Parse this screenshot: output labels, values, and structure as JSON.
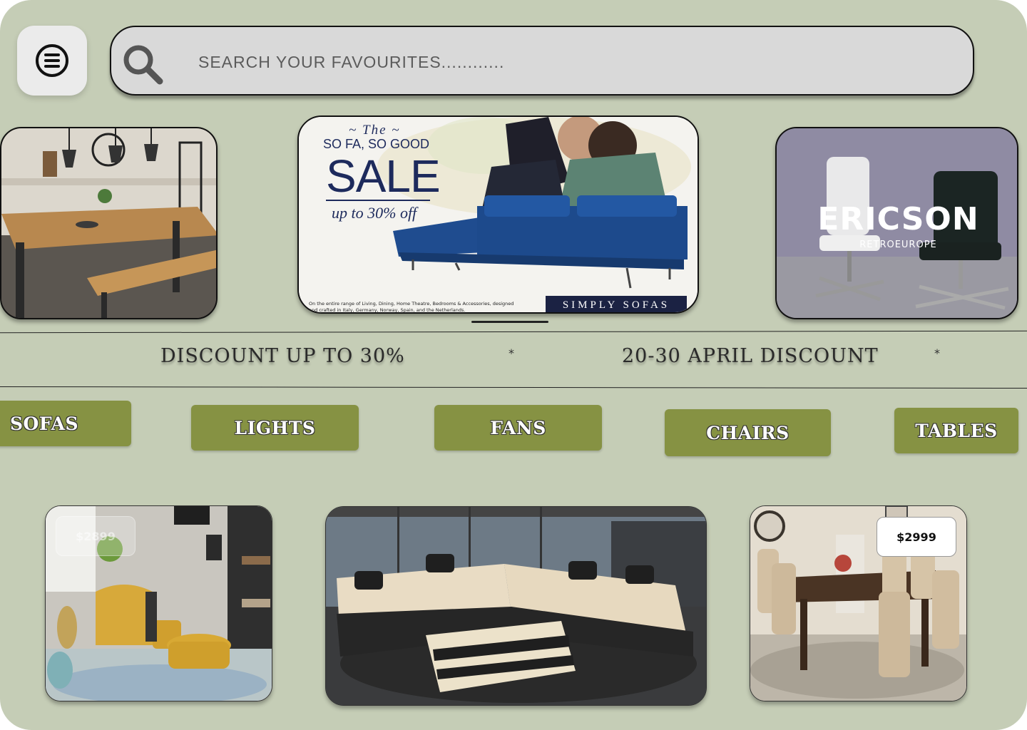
{
  "search": {
    "placeholder": "SEARCH YOUR FAVOURITES............"
  },
  "banners": {
    "sale": {
      "the": "~ The ~",
      "subtitle": "SO FA, SO GOOD",
      "headline": "SALE",
      "offer": "up to 30% off",
      "fine_print": "On the entire range of Living, Dining, Home Theatre, Bedrooms & Accessories, designed and crafted in Italy, Germany, Norway, Spain, and the Netherlands.",
      "brand": "SIMPLY SOFAS"
    },
    "ericson": {
      "name": "ERICSON",
      "sub": "RETROEUROPE"
    }
  },
  "discounts": [
    "DISCOUNT UP TO 30%",
    "20-30 APRIL DISCOUNT"
  ],
  "separator_glyph": "*",
  "categories": [
    "SOFAS",
    "LIGHTS",
    "FANS",
    "CHAIRS",
    "TABLES"
  ],
  "products": [
    {
      "price": "$2899"
    },
    {
      "price": ""
    },
    {
      "price": "$2999"
    }
  ],
  "icons": [
    "menu-icon",
    "search-icon"
  ],
  "colors": {
    "background": "#c5cdb6",
    "category_button": "#869243",
    "search_bar": "#d9d9d9",
    "sale_text": "#1d2a5c"
  }
}
